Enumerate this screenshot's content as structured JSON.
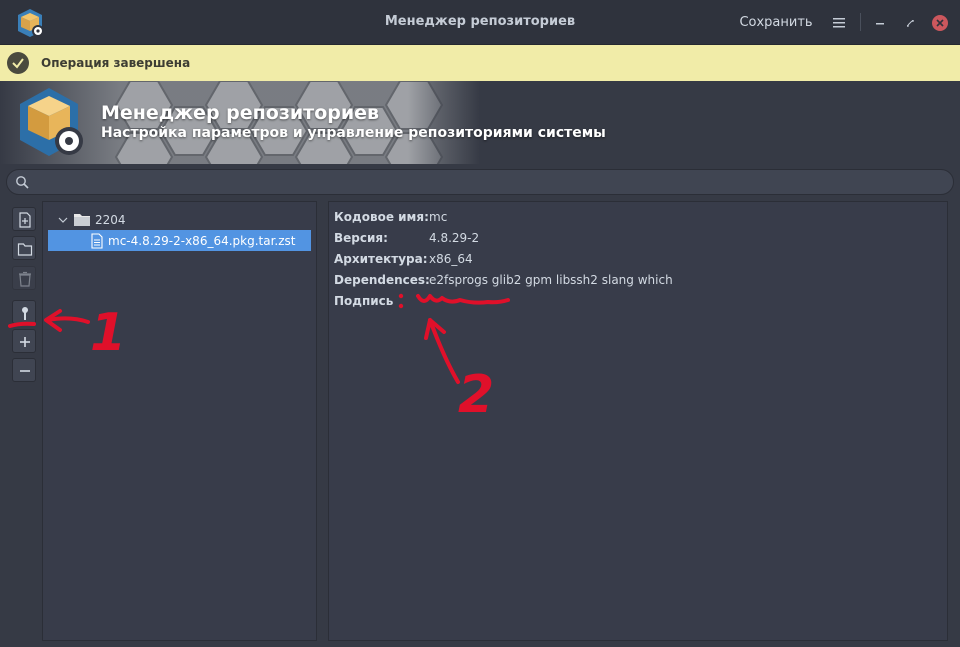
{
  "window": {
    "title": "Менеджер репозиториев",
    "save_label": "Сохранить"
  },
  "notification": {
    "text": "Операция завершена"
  },
  "banner": {
    "title": "Менеджер репозиториев",
    "subtitle": "Настройка параметров и управление репозиториями системы"
  },
  "search": {
    "placeholder": "",
    "value": ""
  },
  "toolbar": {
    "buttons": [
      "add-file-icon",
      "folder-icon",
      "trash-icon",
      "key-icon",
      "plus-icon",
      "minus-icon"
    ]
  },
  "tree": {
    "root_label": "2204",
    "child_label": "mc-4.8.29-2-x86_64.pkg.tar.zst"
  },
  "details": {
    "rows": [
      {
        "key": "Кодовое имя:",
        "value": "mc"
      },
      {
        "key": "Версия:",
        "value": "4.8.29-2"
      },
      {
        "key": "Архитектура:",
        "value": "x86_64"
      },
      {
        "key": "Dependences:",
        "value": "e2fsprogs glib2 gpm libssh2 slang which"
      },
      {
        "key": "Подпись",
        "value": ""
      }
    ]
  },
  "annotations": {
    "label_1": "1",
    "label_2": "2"
  },
  "colors": {
    "accent": "#5294e2",
    "notify_bg": "#f1eca8",
    "close": "#cc575d",
    "annotation": "#e0102a"
  }
}
